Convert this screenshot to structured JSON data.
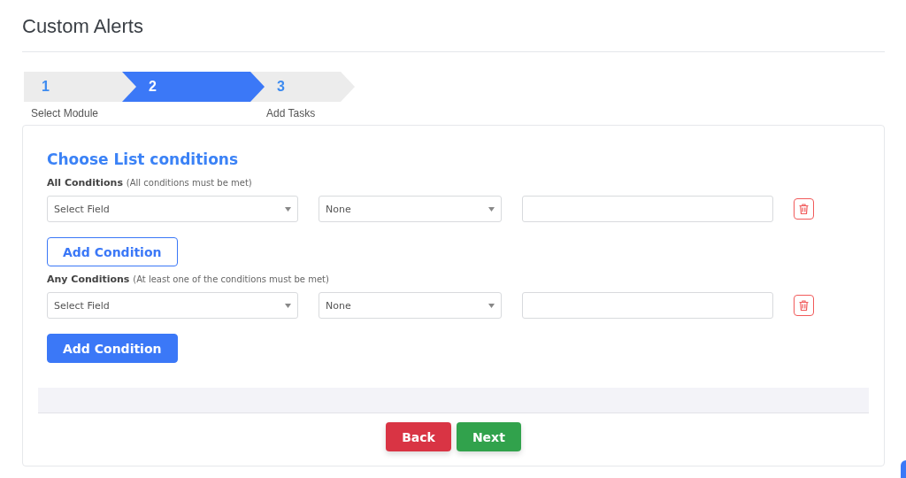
{
  "page": {
    "title": "Custom Alerts"
  },
  "steps": [
    {
      "number": "1",
      "label": "Select Module",
      "selected": false
    },
    {
      "number": "2",
      "selected": true
    },
    {
      "number": "3",
      "label": "Add Tasks",
      "selected": false
    }
  ],
  "panel": {
    "heading": "Choose List conditions",
    "groups": [
      {
        "title": "All Conditions",
        "hint": "(All conditions must be met)",
        "rows": [
          {
            "field": "Select Field",
            "operator": "None"
          }
        ],
        "add_button": {
          "label": "Add Condition",
          "kind": "outline"
        }
      },
      {
        "title": "Any Conditions",
        "hint": "(At least one of the conditions must be met)",
        "rows": [
          {
            "field": "Select Field",
            "operator": "None"
          }
        ],
        "add_button": {
          "label": "Add Condition",
          "kind": "filled"
        }
      }
    ]
  },
  "footer": {
    "buttons": [
      {
        "label": "Back",
        "kind": "danger"
      },
      {
        "label": "Next",
        "kind": "success"
      }
    ]
  }
}
